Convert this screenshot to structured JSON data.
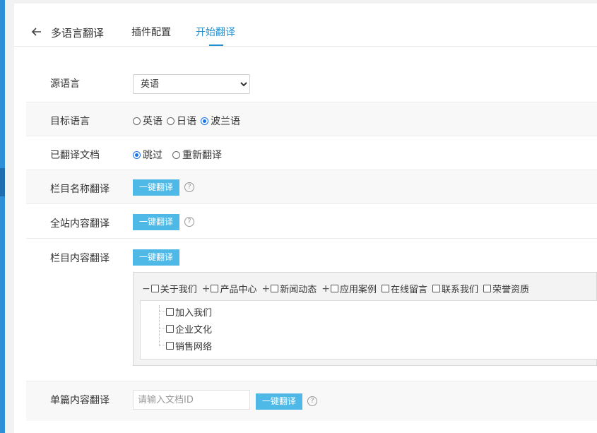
{
  "header": {
    "title": "多语言翻译",
    "tabs": [
      {
        "label": "插件配置",
        "active": false
      },
      {
        "label": "开始翻译",
        "active": true
      }
    ]
  },
  "form": {
    "source_language": {
      "label": "源语言",
      "value": "英语"
    },
    "target_language": {
      "label": "目标语言",
      "options": [
        {
          "label": "英语",
          "checked": false
        },
        {
          "label": "日语",
          "checked": false
        },
        {
          "label": "波兰语",
          "checked": true
        }
      ]
    },
    "translated_docs": {
      "label": "已翻译文档",
      "options": [
        {
          "label": "跳过",
          "checked": true
        },
        {
          "label": "重新翻译",
          "checked": false
        }
      ]
    },
    "column_name": {
      "label": "栏目名称翻译",
      "button": "一键翻译"
    },
    "site_content": {
      "label": "全站内容翻译",
      "button": "一键翻译"
    },
    "column_content": {
      "label": "栏目内容翻译",
      "button": "一键翻译",
      "tree": {
        "top_items": [
          {
            "toggle": "−",
            "label": "关于我们",
            "checked": false
          },
          {
            "toggle": "+",
            "label": "产品中心",
            "checked": false
          },
          {
            "toggle": "+",
            "label": "新闻动态",
            "checked": false
          },
          {
            "toggle": "+",
            "label": "应用案例",
            "checked": false
          },
          {
            "toggle": "",
            "label": "在线留言",
            "checked": false
          },
          {
            "toggle": "",
            "label": "联系我们",
            "checked": false
          },
          {
            "toggle": "",
            "label": "荣誉资质",
            "checked": false
          }
        ],
        "children": [
          {
            "label": "加入我们",
            "checked": false
          },
          {
            "label": "企业文化",
            "checked": false
          },
          {
            "label": "销售网络",
            "checked": false
          }
        ]
      }
    },
    "single_content": {
      "label": "单篇内容翻译",
      "input_placeholder": "请输入文档ID",
      "input_value": "",
      "button": "一键翻译"
    },
    "help_glyph": "?"
  },
  "colors": {
    "accent": "#1e8fd0",
    "button": "#4eb8e6",
    "sidebar": "#2f8fd8"
  },
  "icons": {
    "back": "arrow-left-icon",
    "help": "question-circle-icon",
    "tree_expand": "plus-icon",
    "tree_collapse": "minus-icon"
  }
}
